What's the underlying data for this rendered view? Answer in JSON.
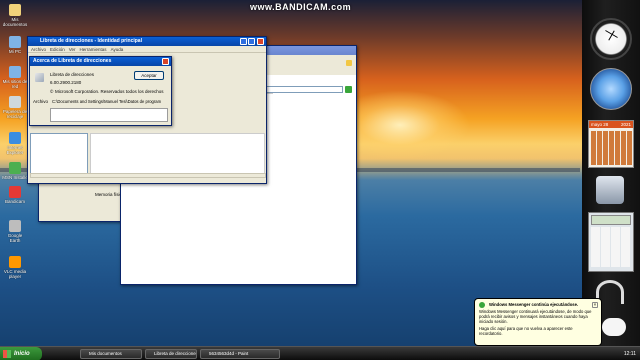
{
  "watermark": "www.BANDICAM.com",
  "desktop_icons": [
    {
      "name": "my-documents-icon",
      "label": "Mis documentos",
      "color": "#f1d27a"
    },
    {
      "name": "my-pc-icon",
      "label": "Mi PC",
      "color": "#7fb3e6"
    },
    {
      "name": "network-places-icon",
      "label": "Mis sitios de red",
      "color": "#7fb3e6"
    },
    {
      "name": "recycle-bin-icon",
      "label": "Papelera de reciclaje",
      "color": "#cfd8dc"
    },
    {
      "name": "internet-explorer-icon",
      "label": "Internet Explorer",
      "color": "#3b8de0"
    },
    {
      "name": "msn-icon",
      "label": "MSN Installe",
      "color": "#4caf50"
    },
    {
      "name": "bandicam-icon",
      "label": "Bandicam",
      "color": "#e53935"
    },
    {
      "name": "setup-icon",
      "label": "Google Earth",
      "color": "#bdbdbd"
    },
    {
      "name": "vlc-icon",
      "label": "VLC media player",
      "color": "#ff9800"
    }
  ],
  "about_window": {
    "title": "Acerca de Libreta de direcciones",
    "app_name": "Libreta de direcciones",
    "version": "6.00.2900.2180",
    "copyright": "Microsoft Corporation. Reservados todos los derechos",
    "archive_label": "Archivo",
    "archive_path": "C:\\Documents and Settings\\Manuel Tesi\\Datos de program",
    "ok_label": "Aceptar"
  },
  "addressbook_window": {
    "title": "Libreta de direcciones - Identidad principal",
    "menu": [
      "Archivo",
      "Edición",
      "Ver",
      "Herramientas",
      "Ayuda"
    ],
    "col_email": "correo electr...",
    "col_phone": "Teléfono del tra...",
    "col_phone2": "Teléfo"
  },
  "sysinfo_window": {
    "memory_label": "Memoria física disponible para Windows:",
    "memory_value": "499.120 KB",
    "ok_label": "Aceptar"
  },
  "sidebar": {
    "calendar_month": "mayo 28",
    "calendar_year": "2021"
  },
  "taskbar": {
    "start_label": "Inicio",
    "tasks": [
      "Mis documentos",
      "Libreta de direcciones",
      "5634563d4d - Paint"
    ],
    "clock": "12:11"
  },
  "balloon": {
    "title": "Windows Messenger continúa ejecutándose.",
    "body": "Windows Messenger continuará ejecutándose, de modo que podrá recibir avisos y mensajes instantáneos cuando haya iniciado sesión.",
    "hint": "Haga clic aquí para que no vuelva a aparecer este recordatorio."
  }
}
